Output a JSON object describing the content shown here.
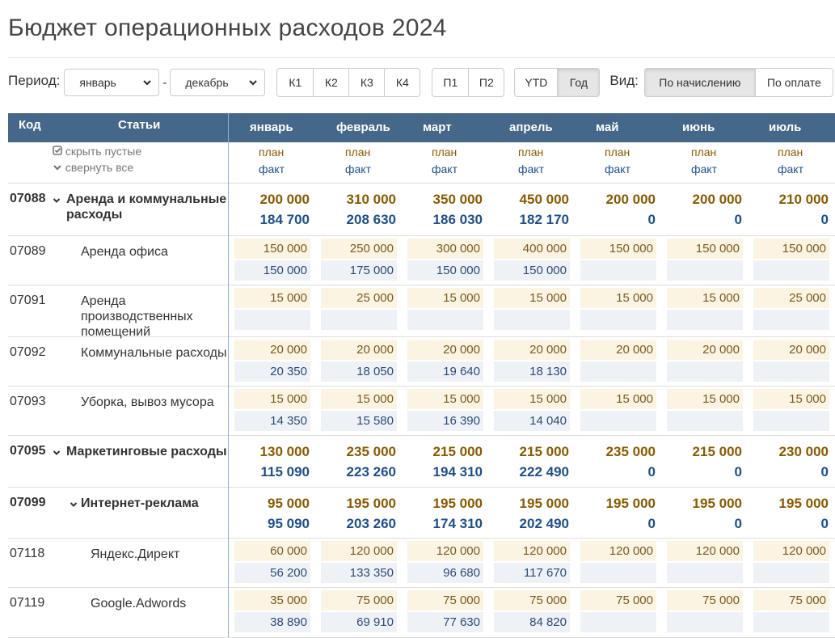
{
  "title": "Бюджет операционных расходов 2024",
  "toolbar": {
    "period_label": "Период:",
    "period_from": "январь",
    "dash": "-",
    "period_to": "декабрь",
    "quarters": [
      "К1",
      "К2",
      "К3",
      "К4"
    ],
    "halves": [
      "П1",
      "П2"
    ],
    "range": [
      {
        "label": "YTD",
        "active": false
      },
      {
        "label": "Год",
        "active": true
      }
    ],
    "view_label": "Вид:",
    "views": [
      {
        "label": "По начислению",
        "active": true
      },
      {
        "label": "По оплате",
        "active": false
      }
    ]
  },
  "table": {
    "code_header": "Код",
    "items_header": "Статьи",
    "hide_empty": "скрыть пустые",
    "collapse_all": "свернуть все",
    "plan_label": "план",
    "fact_label": "факт",
    "months": [
      "январь",
      "февраль",
      "март",
      "апрель",
      "май",
      "июнь",
      "июль"
    ],
    "rows": [
      {
        "code": "07088",
        "name": "Аренда и коммунальные расходы",
        "level": 0,
        "bold": true,
        "plan": [
          "200 000",
          "310 000",
          "350 000",
          "450 000",
          "200 000",
          "200 000",
          "210 000"
        ],
        "fact": [
          "184 700",
          "208 630",
          "186 030",
          "182 170",
          "0",
          "0",
          "0"
        ]
      },
      {
        "code": "07089",
        "name": "Аренда офиса",
        "level": 1,
        "bold": false,
        "plan": [
          "150 000",
          "250 000",
          "300 000",
          "400 000",
          "150 000",
          "150 000",
          "150 000"
        ],
        "fact": [
          "150 000",
          "175 000",
          "150 000",
          "150 000",
          "",
          "",
          ""
        ]
      },
      {
        "code": "07091",
        "name": "Аренда производственных помещений",
        "level": 1,
        "bold": false,
        "plan": [
          "15 000",
          "25 000",
          "15 000",
          "15 000",
          "15 000",
          "15 000",
          "25 000"
        ],
        "fact": [
          "",
          "",
          "",
          "",
          "",
          "",
          ""
        ]
      },
      {
        "code": "07092",
        "name": "Коммунальные расходы",
        "level": 1,
        "bold": false,
        "plan": [
          "20 000",
          "20 000",
          "20 000",
          "20 000",
          "20 000",
          "20 000",
          "20 000"
        ],
        "fact": [
          "20 350",
          "18 050",
          "19 640",
          "18 130",
          "",
          "",
          ""
        ]
      },
      {
        "code": "07093",
        "name": "Уборка, вывоз мусора",
        "level": 1,
        "bold": false,
        "plan": [
          "15 000",
          "15 000",
          "15 000",
          "15 000",
          "15 000",
          "15 000",
          "15 000"
        ],
        "fact": [
          "14 350",
          "15 580",
          "16 390",
          "14 040",
          "",
          "",
          ""
        ]
      },
      {
        "code": "07095",
        "name": "Маркетинговые расходы",
        "level": 0,
        "bold": true,
        "plan": [
          "130 000",
          "235 000",
          "215 000",
          "215 000",
          "235 000",
          "215 000",
          "230 000"
        ],
        "fact": [
          "115 090",
          "223 260",
          "194 310",
          "222 490",
          "0",
          "0",
          "0"
        ]
      },
      {
        "code": "07099",
        "name": "Интернет-реклама",
        "level": 1,
        "bold": true,
        "plan": [
          "95 000",
          "195 000",
          "195 000",
          "195 000",
          "195 000",
          "195 000",
          "195 000"
        ],
        "fact": [
          "95 090",
          "203 260",
          "174 310",
          "202 490",
          "0",
          "0",
          "0"
        ]
      },
      {
        "code": "07118",
        "name": "Яндекс.Директ",
        "level": 2,
        "bold": false,
        "plan": [
          "60 000",
          "120 000",
          "120 000",
          "120 000",
          "120 000",
          "120 000",
          "120 000"
        ],
        "fact": [
          "56 200",
          "133 350",
          "96 680",
          "117 670",
          "",
          "",
          ""
        ]
      },
      {
        "code": "07119",
        "name": "Google.Adwords",
        "level": 2,
        "bold": false,
        "plan": [
          "35 000",
          "75 000",
          "75 000",
          "75 000",
          "75 000",
          "75 000",
          "75 000"
        ],
        "fact": [
          "38 890",
          "69 910",
          "77 630",
          "84 820",
          "",
          "",
          ""
        ]
      }
    ]
  },
  "colors": {
    "header_bg": "#456789",
    "plan": "#8a5a00",
    "fact": "#1f4e8c",
    "plan_bg": "#fbf4e2",
    "fact_bg": "#eef2f6"
  }
}
